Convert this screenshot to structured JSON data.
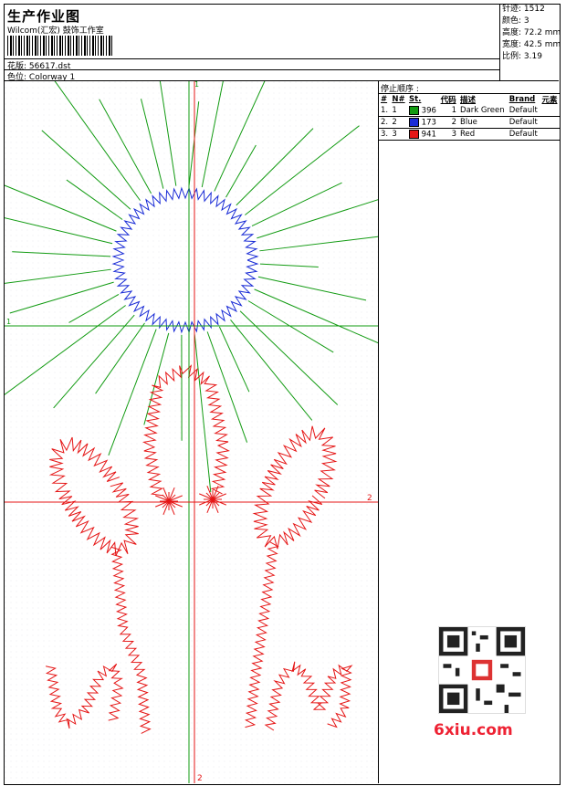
{
  "header": {
    "title": "生产作业图",
    "company": "Wilcom(汇宏) 鼓饰工作室",
    "pattern_label": "花版:",
    "pattern_value": "56617.dst",
    "color_label": "色位:",
    "color_value": "Colorway 1"
  },
  "stats": {
    "stitches": "针迹: 1512",
    "colors": "颜色: 3",
    "height": "高度: 72.2 mm",
    "width": "宽度: 42.5 mm",
    "ratio": "比例: 3.19"
  },
  "stops": {
    "title": "停止顺序 :",
    "headers": [
      "#",
      "N#",
      "St.",
      "代码",
      "描述",
      "Brand",
      "元素"
    ],
    "rows": [
      {
        "num": "1.",
        "n": "1",
        "st": "396",
        "code": "1",
        "desc": "Dark Green",
        "brand": "Default",
        "color": "#129b12"
      },
      {
        "num": "2.",
        "n": "2",
        "st": "173",
        "code": "2",
        "desc": "Blue",
        "brand": "Default",
        "color": "#1a2cd6"
      },
      {
        "num": "3.",
        "n": "3",
        "st": "941",
        "code": "3",
        "desc": "Red",
        "brand": "Default",
        "color": "#e51616"
      }
    ]
  },
  "axis_labels": {
    "green_top": "1",
    "green_left": "1",
    "red_right": "2",
    "red_bottom": "2"
  },
  "colors": {
    "green": "#129b12",
    "blue": "#1a2cd6",
    "red": "#e51616"
  },
  "watermark": {
    "text": "6xiu.com"
  }
}
